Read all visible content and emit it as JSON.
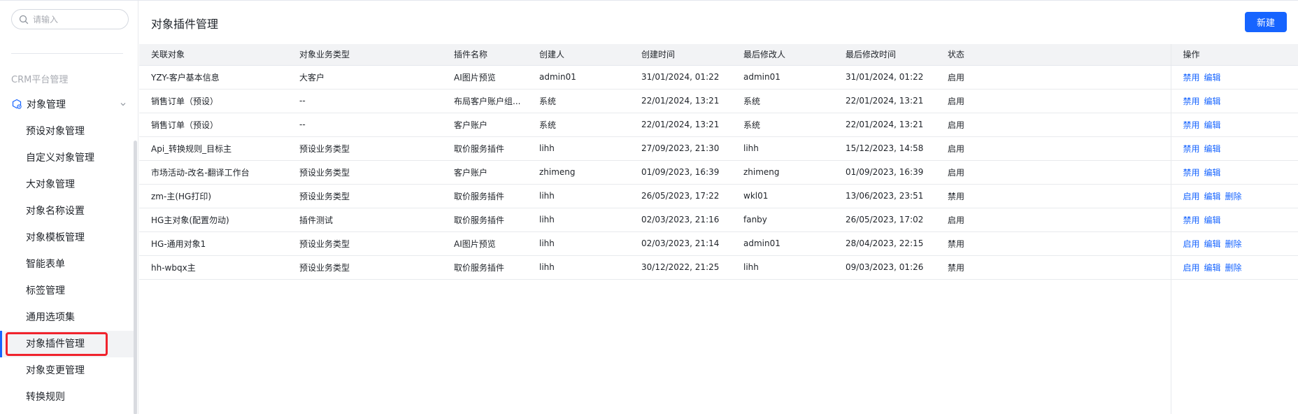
{
  "sidebar": {
    "search_placeholder": "请输入",
    "section_label": "CRM平台管理",
    "group_label": "对象管理",
    "items": [
      {
        "label": "预设对象管理"
      },
      {
        "label": "自定义对象管理"
      },
      {
        "label": "大对象管理"
      },
      {
        "label": "对象名称设置"
      },
      {
        "label": "对象模板管理"
      },
      {
        "label": "智能表单"
      },
      {
        "label": "标签管理"
      },
      {
        "label": "通用选项集"
      },
      {
        "label": "对象插件管理",
        "active": true
      },
      {
        "label": "对象变更管理"
      },
      {
        "label": "转换规则"
      }
    ]
  },
  "main": {
    "title": "对象插件管理",
    "new_button": "新建",
    "columns": [
      "关联对象",
      "对象业务类型",
      "插件名称",
      "创建人",
      "创建时间",
      "最后修改人",
      "最后修改时间",
      "状态",
      "操作"
    ],
    "rows": [
      {
        "obj": "YZY-客户基本信息",
        "type": "大客户",
        "plugin": "AI图片预览",
        "creator": "admin01",
        "created": "31/01/2024, 01:22",
        "modifier": "admin01",
        "modified": "31/01/2024, 01:22",
        "status": "启用",
        "ops": [
          "禁用",
          "编辑"
        ]
      },
      {
        "obj": "销售订单（预设）",
        "type": "--",
        "plugin": "布局客户账户组...",
        "creator": "系统",
        "created": "22/01/2024, 13:21",
        "modifier": "系统",
        "modified": "22/01/2024, 13:21",
        "status": "启用",
        "ops": [
          "禁用",
          "编辑"
        ]
      },
      {
        "obj": "销售订单（预设）",
        "type": "--",
        "plugin": "客户账户",
        "creator": "系统",
        "created": "22/01/2024, 13:21",
        "modifier": "系统",
        "modified": "22/01/2024, 13:21",
        "status": "启用",
        "ops": [
          "禁用",
          "编辑"
        ]
      },
      {
        "obj": "Api_转换规则_目标主",
        "type": "预设业务类型",
        "plugin": "取价服务插件",
        "creator": "lihh",
        "created": "27/09/2023, 21:30",
        "modifier": "lihh",
        "modified": "15/12/2023, 14:58",
        "status": "启用",
        "ops": [
          "禁用",
          "编辑"
        ]
      },
      {
        "obj": "市场活动-改名-翻译工作台",
        "type": "预设业务类型",
        "plugin": "客户账户",
        "creator": "zhimeng",
        "created": "01/09/2023, 16:39",
        "modifier": "zhimeng",
        "modified": "01/09/2023, 16:39",
        "status": "启用",
        "ops": [
          "禁用",
          "编辑"
        ]
      },
      {
        "obj": "zm-主(HG打印)",
        "type": "预设业务类型",
        "plugin": "取价服务插件",
        "creator": "lihh",
        "created": "26/05/2023, 17:22",
        "modifier": "wkl01",
        "modified": "13/06/2023, 23:51",
        "status": "禁用",
        "ops": [
          "启用",
          "编辑",
          "删除"
        ]
      },
      {
        "obj": "HG主对象(配置勿动)",
        "type": "插件测试",
        "plugin": "取价服务插件",
        "creator": "lihh",
        "created": "02/03/2023, 21:16",
        "modifier": "fanby",
        "modified": "26/05/2023, 17:02",
        "status": "启用",
        "ops": [
          "禁用",
          "编辑"
        ]
      },
      {
        "obj": "HG-通用对象1",
        "type": "预设业务类型",
        "plugin": "AI图片预览",
        "creator": "lihh",
        "created": "02/03/2023, 21:14",
        "modifier": "admin01",
        "modified": "28/04/2023, 22:15",
        "status": "禁用",
        "ops": [
          "启用",
          "编辑",
          "删除"
        ]
      },
      {
        "obj": "hh-wbqx主",
        "type": "预设业务类型",
        "plugin": "取价服务插件",
        "creator": "lihh",
        "created": "30/12/2022, 21:25",
        "modifier": "lihh",
        "modified": "09/03/2023, 01:26",
        "status": "禁用",
        "ops": [
          "启用",
          "编辑",
          "删除"
        ]
      }
    ]
  },
  "colors": {
    "accent": "#1664ff",
    "highlight": "#f0232d"
  }
}
